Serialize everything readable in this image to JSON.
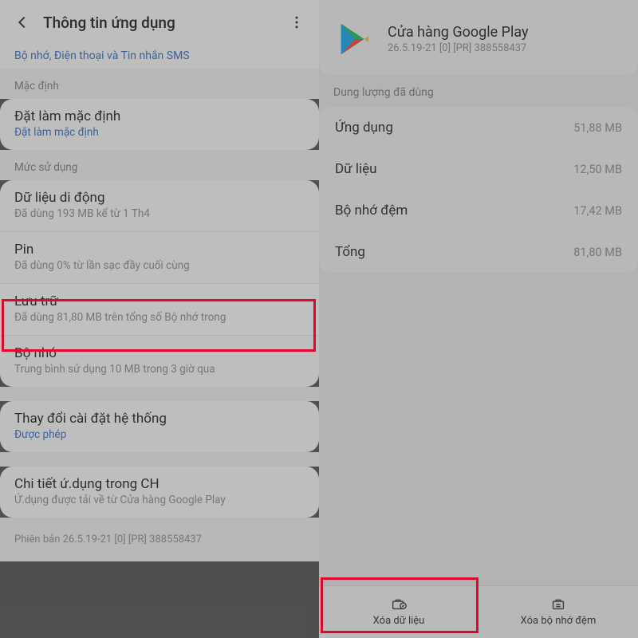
{
  "left": {
    "header_title": "Thông tin ứng dụng",
    "truncated_perms": "Bộ nhớ, Điện thoại và Tin nhắn SMS",
    "sections": {
      "default": {
        "label": "Mặc định",
        "set_default": {
          "title": "Đặt làm mặc định",
          "sub": "Đặt làm mặc định"
        }
      },
      "usage": {
        "label": "Mức sử dụng",
        "mobile": {
          "title": "Dữ liệu di động",
          "sub": "Đã dùng 193 MB kể từ 1 Th4"
        },
        "battery": {
          "title": "Pin",
          "sub": "Đã dùng 0% từ lần sạc đầy cuối cùng"
        },
        "storage": {
          "title": "Lưu trữ",
          "sub": "Đã dùng 81,80 MB trên tổng số Bộ nhớ trong"
        },
        "memory": {
          "title": "Bộ nhớ",
          "sub": "Trung bình sử dụng 10 MB trong 3 giờ qua"
        }
      },
      "system": {
        "title": "Thay đổi cài đặt hệ thống",
        "sub": "Được phép"
      },
      "store": {
        "title": "Chi tiết ứ.dụng trong CH",
        "sub": "Ứ.dụng được tải về từ Cửa hàng Google Play"
      }
    },
    "version": "Phiên bản 26.5.19-21 [0] [PR] 388558437"
  },
  "right": {
    "app_name": "Cửa hàng Google Play",
    "app_version": "26.5.19-21 [0] [PR] 388558437",
    "usage_label": "Dung lượng đã dùng",
    "rows": {
      "app": {
        "name": "Ứng dụng",
        "val": "51,88 MB"
      },
      "data": {
        "name": "Dữ liệu",
        "val": "12,50 MB"
      },
      "cache": {
        "name": "Bộ nhớ đệm",
        "val": "17,42 MB"
      },
      "total": {
        "name": "Tổng",
        "val": "81,80 MB"
      }
    },
    "footer": {
      "clear_data": "Xóa dữ liệu",
      "clear_cache": "Xóa bộ nhớ đệm"
    }
  }
}
